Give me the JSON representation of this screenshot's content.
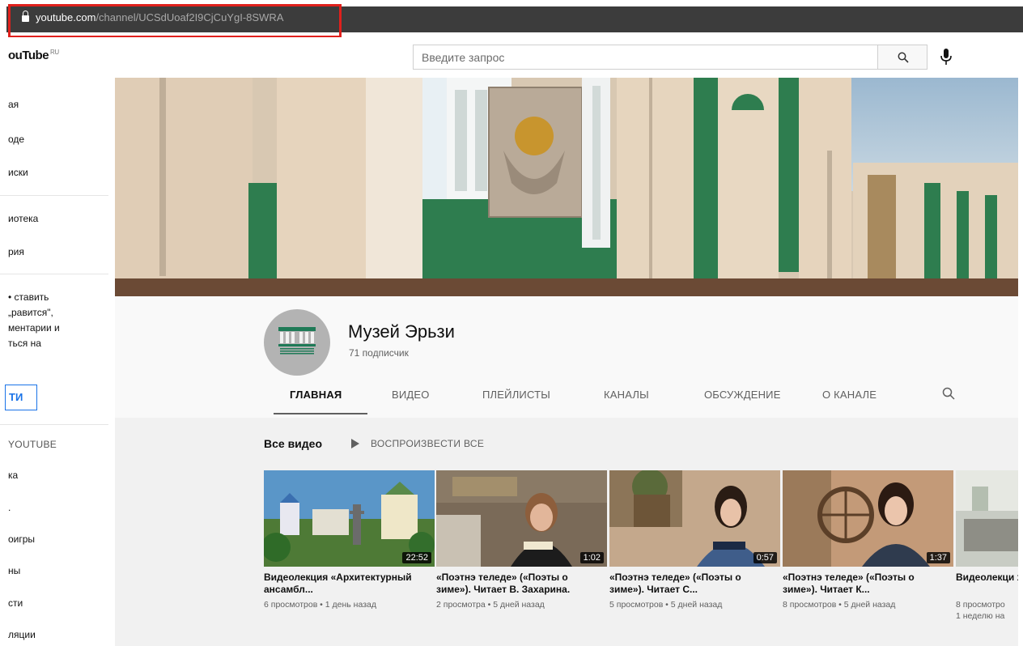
{
  "browser": {
    "url_domain": "youtube.com",
    "url_path": "/channel/UCSdUoaf2I9CjCuYgI-8SWRA"
  },
  "masthead": {
    "logo": "ouTube",
    "logo_region": "RU",
    "search_placeholder": "Введите запрос"
  },
  "sidebar": {
    "items_top": [
      "ая",
      "оде",
      "иски"
    ],
    "items_mid": [
      "иотека",
      "рия"
    ],
    "note": "• ставить\n„равится\",\nментарии и\nться на",
    "signin_label": "ТИ",
    "section_heading": "YOUTUBE",
    "items_bottom": [
      "ка",
      ".",
      "оигры",
      "ны",
      "сти",
      "ляции"
    ]
  },
  "channel": {
    "name": "Музей Эрьзи",
    "subscribers": "71 подписчик",
    "tabs": [
      "ГЛАВНАЯ",
      "ВИДЕО",
      "ПЛЕЙЛИСТЫ",
      "КАНАЛЫ",
      "ОБСУЖДЕНИЕ",
      "О КАНАЛЕ"
    ],
    "active_tab": "ГЛАВНАЯ"
  },
  "shelf": {
    "title": "Все видео",
    "play_all": "ВОСПРОИЗВЕСТИ ВСЕ"
  },
  "videos": [
    {
      "title": "Видеолекция «Архитектурный ансамбл...",
      "meta": "6 просмотров • 1 день назад",
      "duration": "22:52"
    },
    {
      "title": "«Поэтнэ теледе» («Поэты о зиме»). Читает В. Захарина.",
      "meta": "2 просмотра • 5 дней назад",
      "duration": "1:02"
    },
    {
      "title": "«Поэтнэ теледе» («Поэты о зиме»). Читает С...",
      "meta": "5 просмотров • 5 дней назад",
      "duration": "0:57"
    },
    {
      "title": "«Поэтнэ теледе» («Поэты о зиме»). Читает К...",
      "meta": "8 просмотров • 5 дней назад",
      "duration": "1:37"
    },
    {
      "title": "Видеолекци хрусталь»",
      "meta": "8 просмотро",
      "meta2": "1 неделю на",
      "duration": ""
    }
  ],
  "colors": {
    "url_highlight": "#e0201c",
    "active_tab": "#0f0f0f",
    "building_green": "#2e7d4f"
  }
}
